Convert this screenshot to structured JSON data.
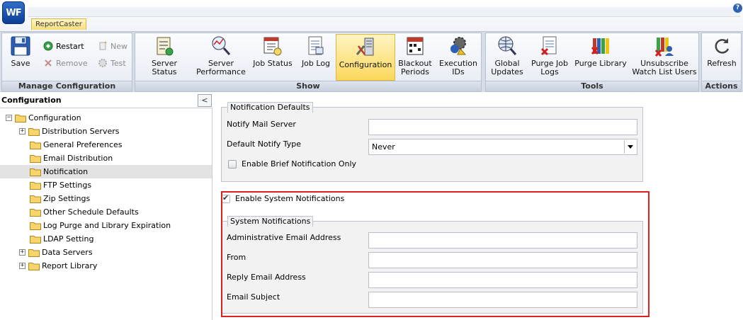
{
  "app": {
    "logo_text": "WF",
    "tab": "ReportCaster",
    "help": "?"
  },
  "ribbon": {
    "manage": {
      "label": "Manage Configuration",
      "save": "Save",
      "restart": "Restart",
      "remove": "Remove",
      "new": "New",
      "test": "Test"
    },
    "show": {
      "label": "Show",
      "items": [
        "Server Status",
        "Server Performance",
        "Job Status",
        "Job Log",
        "Configuration",
        "Blackout Periods",
        "Execution IDs"
      ]
    },
    "tools": {
      "label": "Tools",
      "items": [
        "Global Updates",
        "Purge Job Logs",
        "Purge Library",
        "Unsubscribe Watch List Users"
      ]
    },
    "actions": {
      "label": "Actions",
      "refresh": "Refresh"
    }
  },
  "tree": {
    "title": "Configuration",
    "collapse": "<",
    "root": "Configuration",
    "items": [
      "Distribution Servers",
      "General Preferences",
      "Email Distribution",
      "Notification",
      "FTP Settings",
      "Zip Settings",
      "Other Schedule Defaults",
      "Log Purge and Library Expiration",
      "LDAP Setting",
      "Data Servers",
      "Report Library"
    ]
  },
  "notification_defaults": {
    "legend": "Notification Defaults",
    "mail_server_label": "Notify Mail Server",
    "mail_server_value": "",
    "notify_type_label": "Default Notify Type",
    "notify_type_value": "Never",
    "brief_label": "Enable Brief Notification Only"
  },
  "system_notifications": {
    "enable_label": "Enable System Notifications",
    "legend": "System Notifications",
    "admin_email_label": "Administrative Email Address",
    "from_label": "From",
    "reply_label": "Reply Email Address",
    "subject_label": "Email Subject"
  },
  "colors": {
    "highlight_border": "#e02020",
    "active_button": "#fbd85b",
    "selected_row": "#e3e3e3"
  }
}
